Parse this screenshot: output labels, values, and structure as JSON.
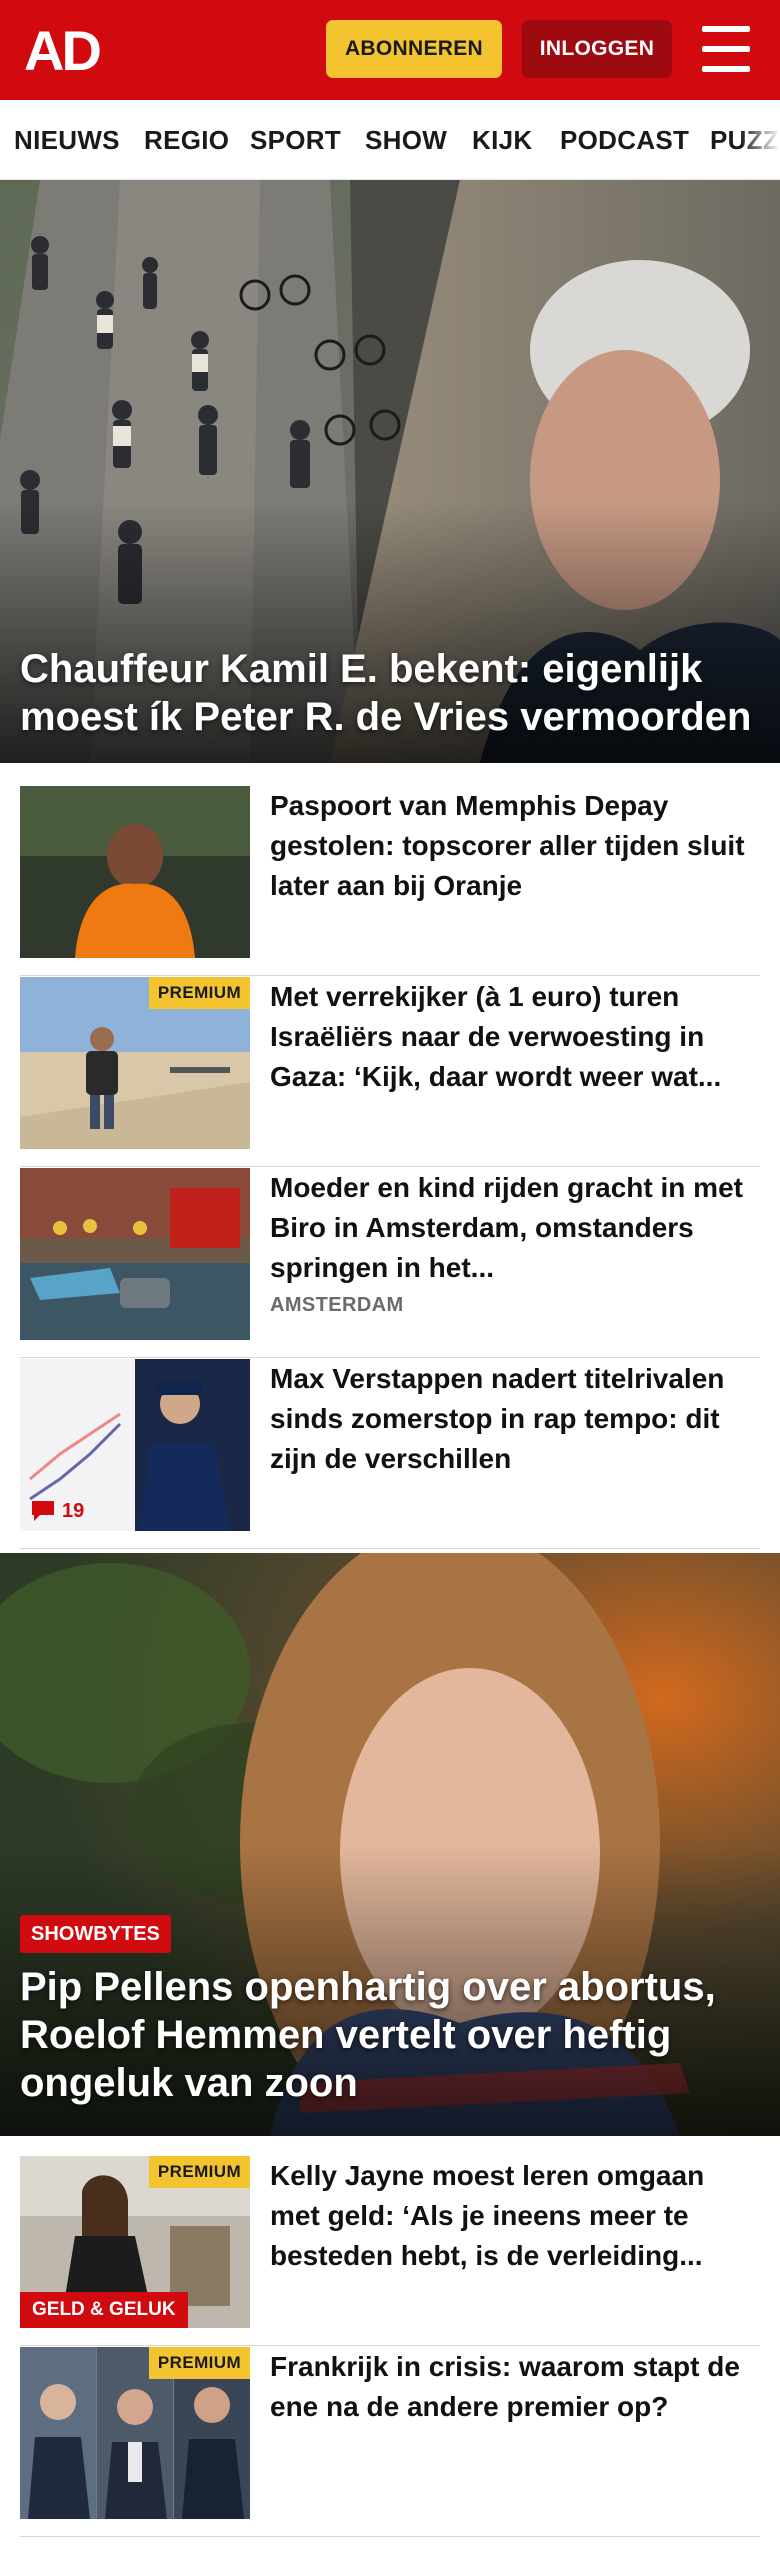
{
  "header": {
    "logo_text": "AD",
    "subscribe_label": "ABONNEREN",
    "login_label": "INLOGGEN",
    "menu_icon": "hamburger-icon",
    "brand_color": "#d10a10",
    "accent_color": "#f4c430"
  },
  "nav": {
    "items": [
      {
        "label": "NIEUWS"
      },
      {
        "label": "REGIO"
      },
      {
        "label": "SPORT"
      },
      {
        "label": "SHOW"
      },
      {
        "label": "KIJK"
      },
      {
        "label": "PODCAST"
      },
      {
        "label": "PUZZ"
      }
    ]
  },
  "hero1": {
    "headline": "Chauffeur Kamil E. bekent: eigenlijk moest ík Peter R. de Vries vermoorden"
  },
  "articles1": [
    {
      "title": "Paspoort van Memphis Depay gestolen: topscorer aller tijden sluit later aan bij Oranje"
    },
    {
      "title": "Met verrekijker (à 1 euro) turen Israëliërs naar de verwoesting in Gaza: ‘Kijk, daar wordt weer wat...",
      "premium": "PREMIUM"
    },
    {
      "title": "Moeder en kind rijden gracht in met Biro in Amsterdam, omstanders springen in het...",
      "section": "AMSTERDAM"
    },
    {
      "title": "Max Verstappen nadert titelriva­len sinds zomerstop in rap tempo: dit zijn de verschillen",
      "comments": "19",
      "comment_icon": "comment-icon"
    }
  ],
  "hero2": {
    "badge": "SHOWBYTES",
    "headline": "Pip Pellens openhartig over abortus, Roelof Hemmen vertelt over heftig ongeluk van zoon"
  },
  "articles2": [
    {
      "title": "Kelly Jayne moest leren omgaan met geld: ‘Als je ineens meer te besteden hebt, is de verleiding...",
      "premium": "PREMIUM",
      "badge": "GELD & GELUK"
    },
    {
      "title": "Frankrijk in crisis: waarom stapt de ene na de andere premier op?",
      "premium": "PREMIUM"
    }
  ]
}
